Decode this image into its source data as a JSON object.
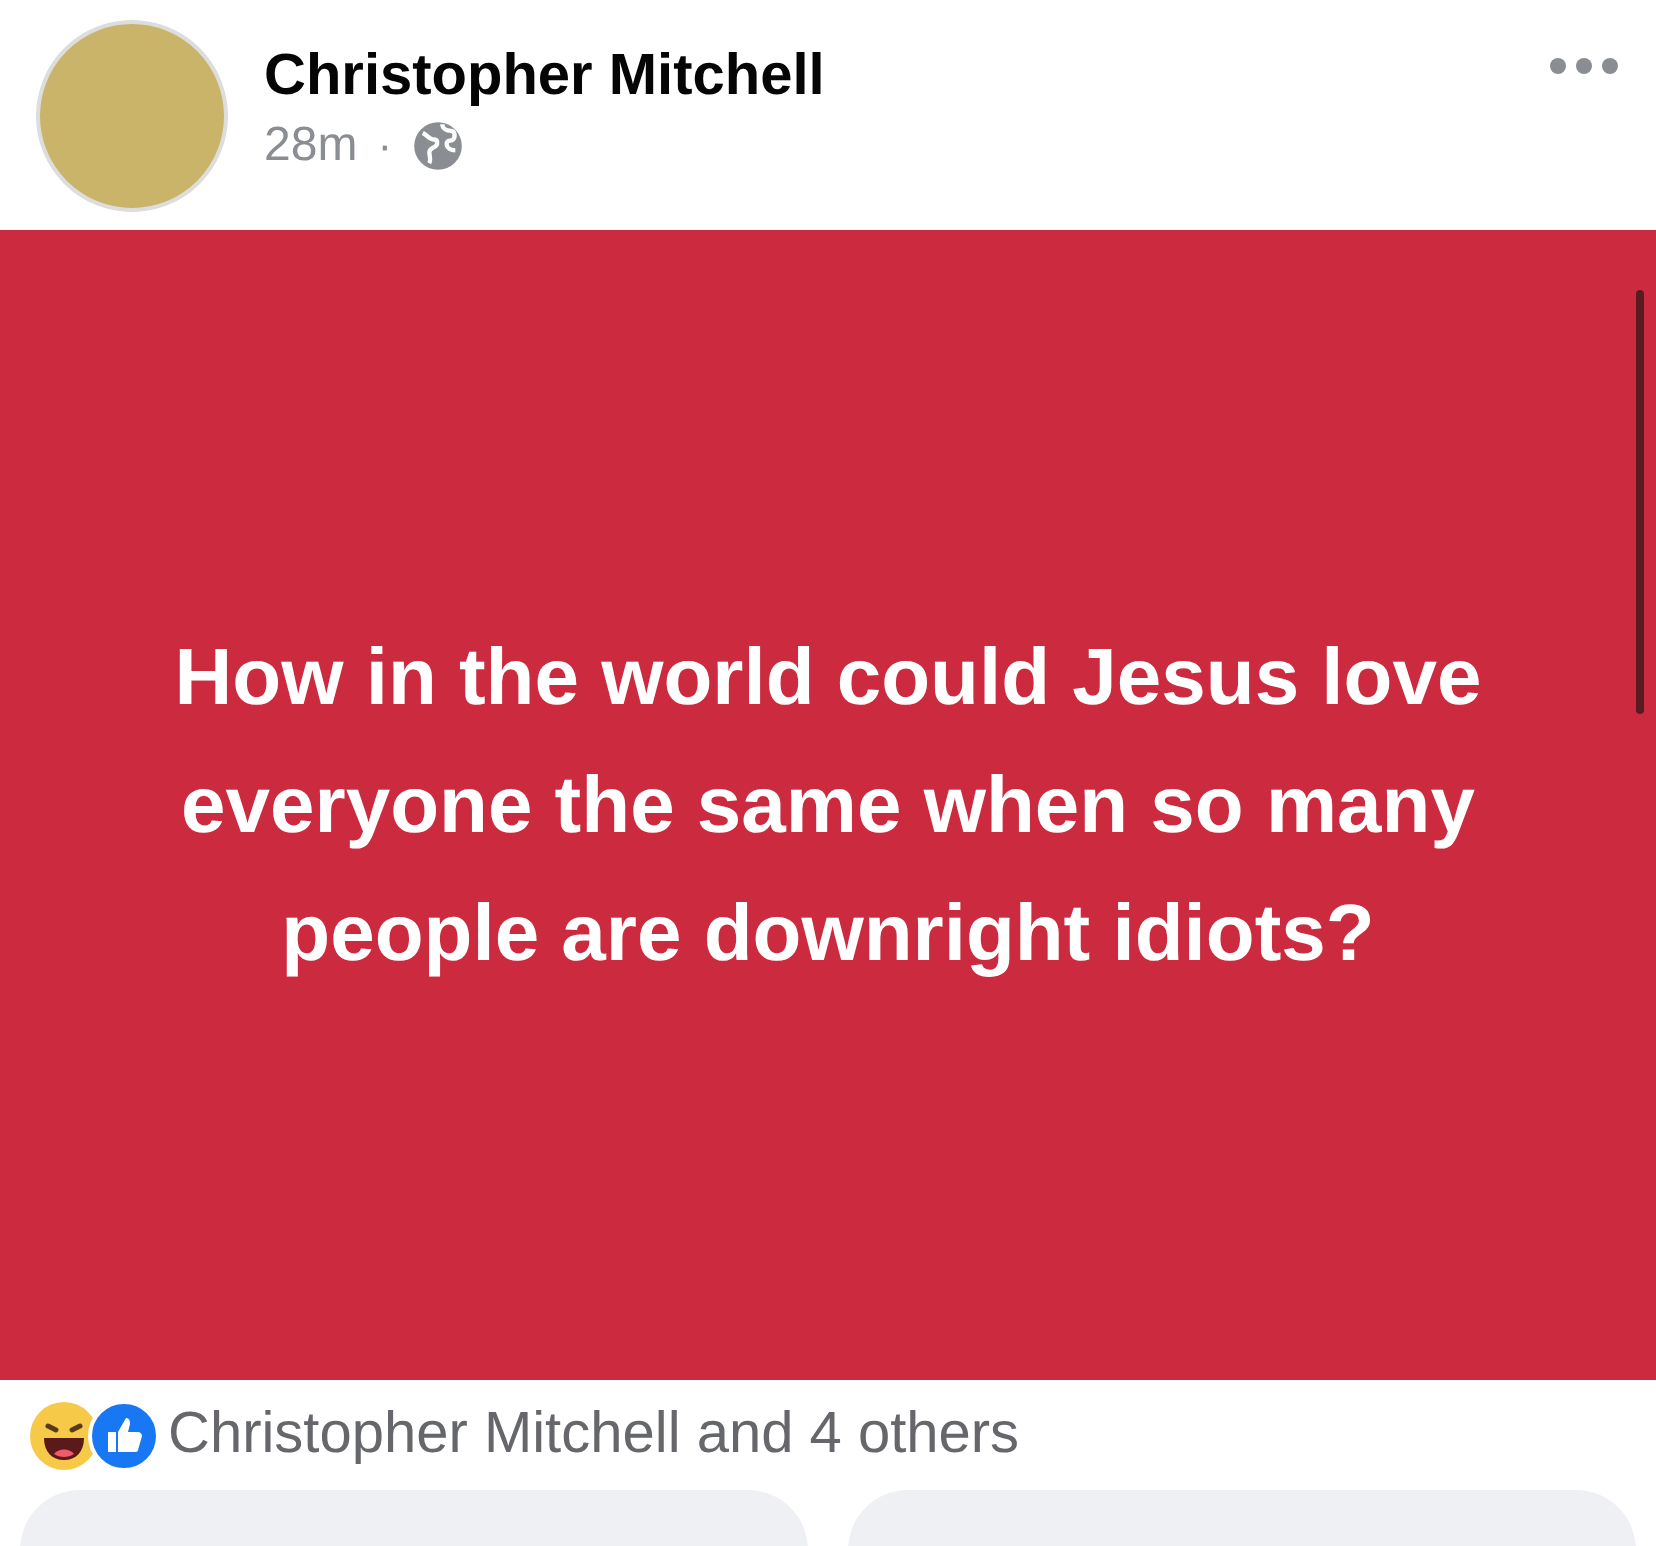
{
  "post": {
    "author": "Christopher Mitchell",
    "time": "28m",
    "separator": "·",
    "text": "How in the world could Jesus love everyone the same when so many people are downright idiots?"
  },
  "reactions": {
    "summary": "Christopher Mitchell and 4 others"
  }
}
